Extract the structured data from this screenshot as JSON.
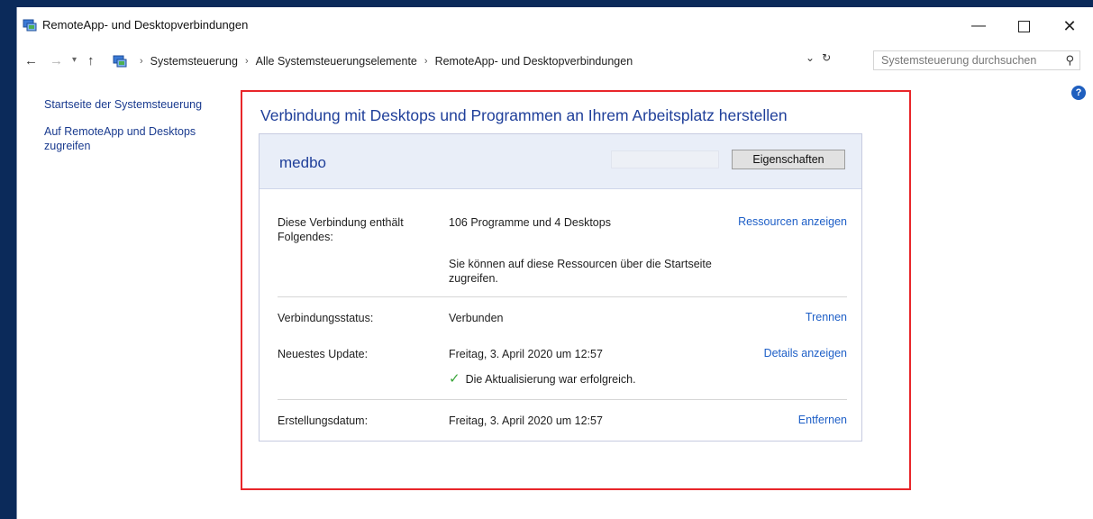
{
  "window": {
    "title": "RemoteApp- und Desktopverbindungen",
    "controls": {
      "minimize": "—",
      "close": "✕"
    }
  },
  "nav": {
    "breadcrumbs": [
      "Systemsteuerung",
      "Alle Systemsteuerungselemente",
      "RemoteApp- und Desktopverbindungen"
    ],
    "search_placeholder": "Systemsteuerung durchsuchen"
  },
  "sidebar": {
    "items": [
      {
        "label": "Startseite der Systemsteuerung"
      },
      {
        "label": "Auf RemoteApp und Desktops zugreifen"
      }
    ]
  },
  "main": {
    "heading": "Verbindung mit Desktops und Programmen an Ihrem Arbeitsplatz herstellen",
    "connection": {
      "name": "medbo",
      "properties_button": "Eigenschaften",
      "contents_label": "Diese Verbindung enthält Folgendes:",
      "contents_value": "106 Programme und 4 Desktops",
      "contents_action": "Ressourcen anzeigen",
      "contents_note": "Sie können auf diese Ressourcen über die Startseite zugreifen.",
      "status_label": "Verbindungsstatus:",
      "status_value": "Verbunden",
      "status_action": "Trennen",
      "update_label": "Neuestes Update:",
      "update_value": "Freitag, 3. April 2020 um 12:57",
      "update_action": "Details anzeigen",
      "update_result": "Die Aktualisierung war erfolgreich.",
      "created_label": "Erstellungsdatum:",
      "created_value": "Freitag, 3. April 2020 um 12:57",
      "created_action": "Entfernen"
    }
  },
  "colors": {
    "link": "#1e5fc7",
    "heading": "#1f3f9a",
    "highlight_frame": "#e8262a",
    "success": "#3aa63a"
  },
  "icons": {
    "app": "remote-desktop-icon",
    "help": "help-icon",
    "search": "search-icon",
    "success": "check-icon"
  }
}
